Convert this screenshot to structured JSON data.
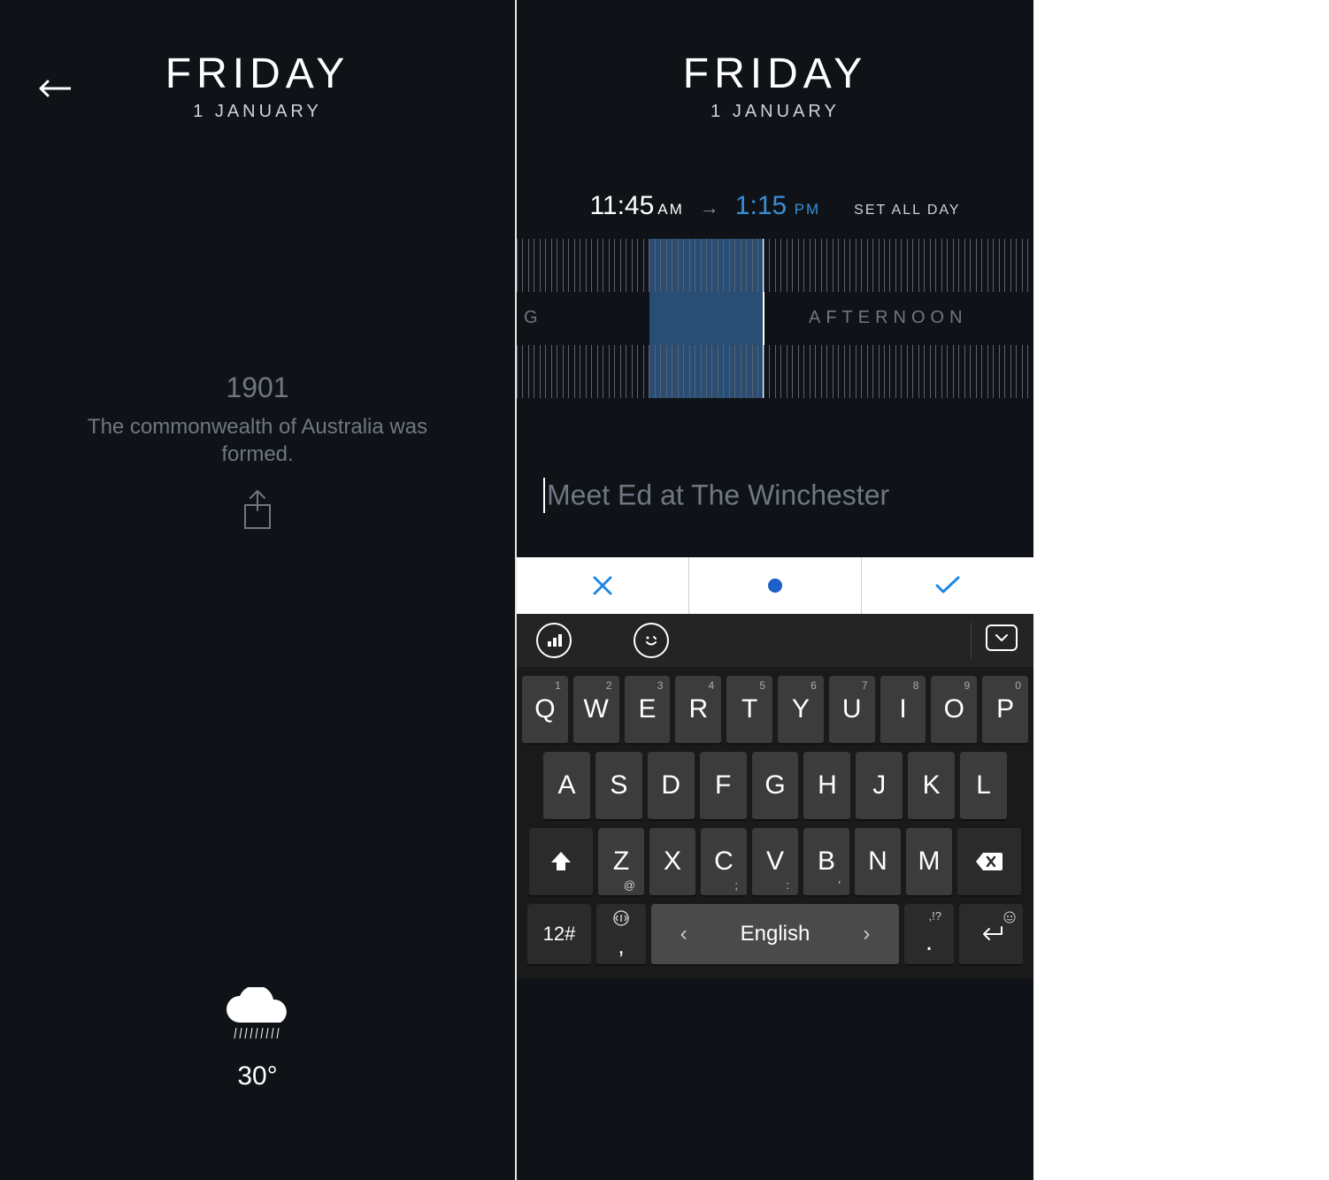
{
  "left": {
    "day": "FRIDAY",
    "date": "1 JANUARY",
    "fact_year": "1901",
    "fact_text": "The commonwealth of Australia was formed.",
    "temperature": "30°"
  },
  "right": {
    "day": "FRIDAY",
    "date": "1 JANUARY",
    "start_time": "11:45",
    "start_ampm": "AM",
    "end_time": "1:15",
    "end_ampm": "PM",
    "set_all_day": "SET ALL DAY",
    "timeline_label_left": "G",
    "timeline_label_right": "AFTERNOON",
    "event_placeholder": "Meet Ed at The Winchester",
    "keyboard": {
      "row1": [
        {
          "n": "1",
          "c": "Q"
        },
        {
          "n": "2",
          "c": "W"
        },
        {
          "n": "3",
          "c": "E"
        },
        {
          "n": "4",
          "c": "R"
        },
        {
          "n": "5",
          "c": "T"
        },
        {
          "n": "6",
          "c": "Y"
        },
        {
          "n": "7",
          "c": "U"
        },
        {
          "n": "8",
          "c": "I"
        },
        {
          "n": "9",
          "c": "O"
        },
        {
          "n": "0",
          "c": "P"
        }
      ],
      "row2": [
        "A",
        "S",
        "D",
        "F",
        "G",
        "H",
        "J",
        "K",
        "L"
      ],
      "row3": [
        {
          "c": "Z",
          "sub": "@"
        },
        {
          "c": "X"
        },
        {
          "c": "C",
          "sub": ";"
        },
        {
          "c": "V",
          "sub": ":"
        },
        {
          "c": "B",
          "sub": "'"
        },
        {
          "c": "N"
        },
        {
          "c": "M"
        }
      ],
      "sym_label": "12#",
      "comma": ",",
      "space_label": "English",
      "dot": ".",
      "dot_sub": ",!?"
    }
  }
}
